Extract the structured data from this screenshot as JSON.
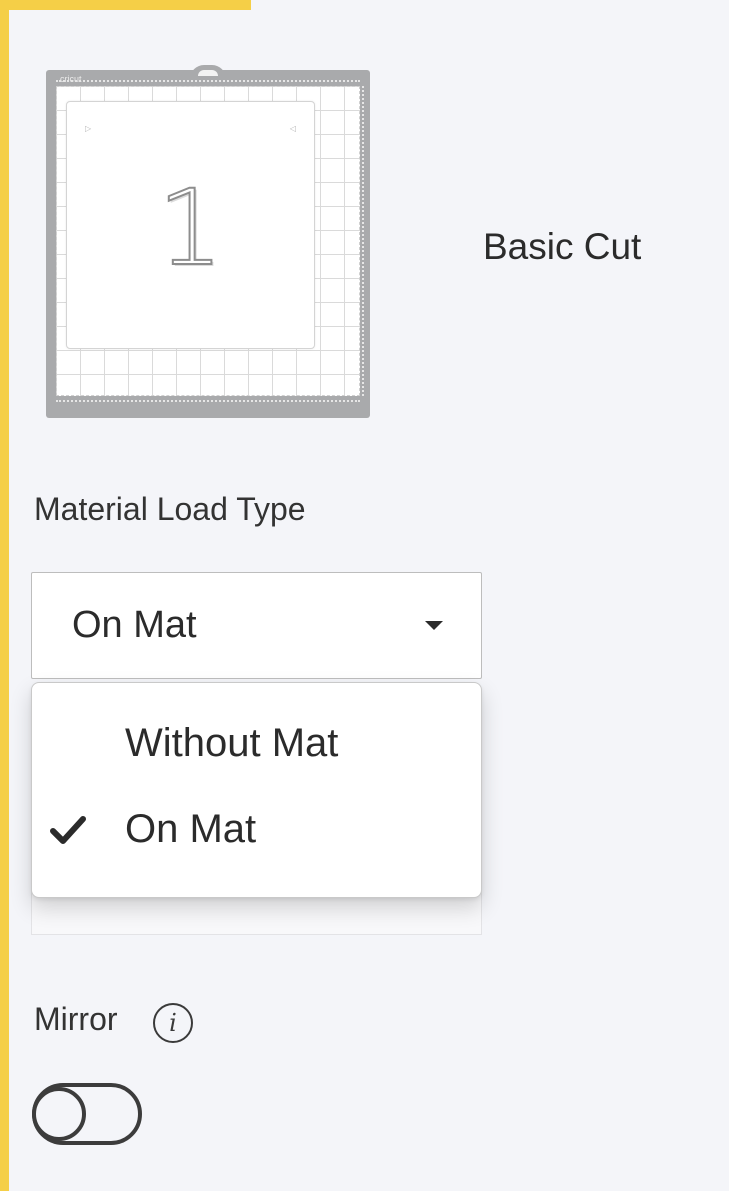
{
  "accent_color": "#f5cf47",
  "mat": {
    "brand": "cricut",
    "number": "1"
  },
  "cut_type": "Basic Cut",
  "material_load": {
    "label": "Material Load Type",
    "selected": "On Mat",
    "options": [
      {
        "label": "Without Mat",
        "checked": false
      },
      {
        "label": "On Mat",
        "checked": true
      }
    ]
  },
  "mirror": {
    "label": "Mirror",
    "info_icon": "info-icon",
    "enabled": false
  }
}
